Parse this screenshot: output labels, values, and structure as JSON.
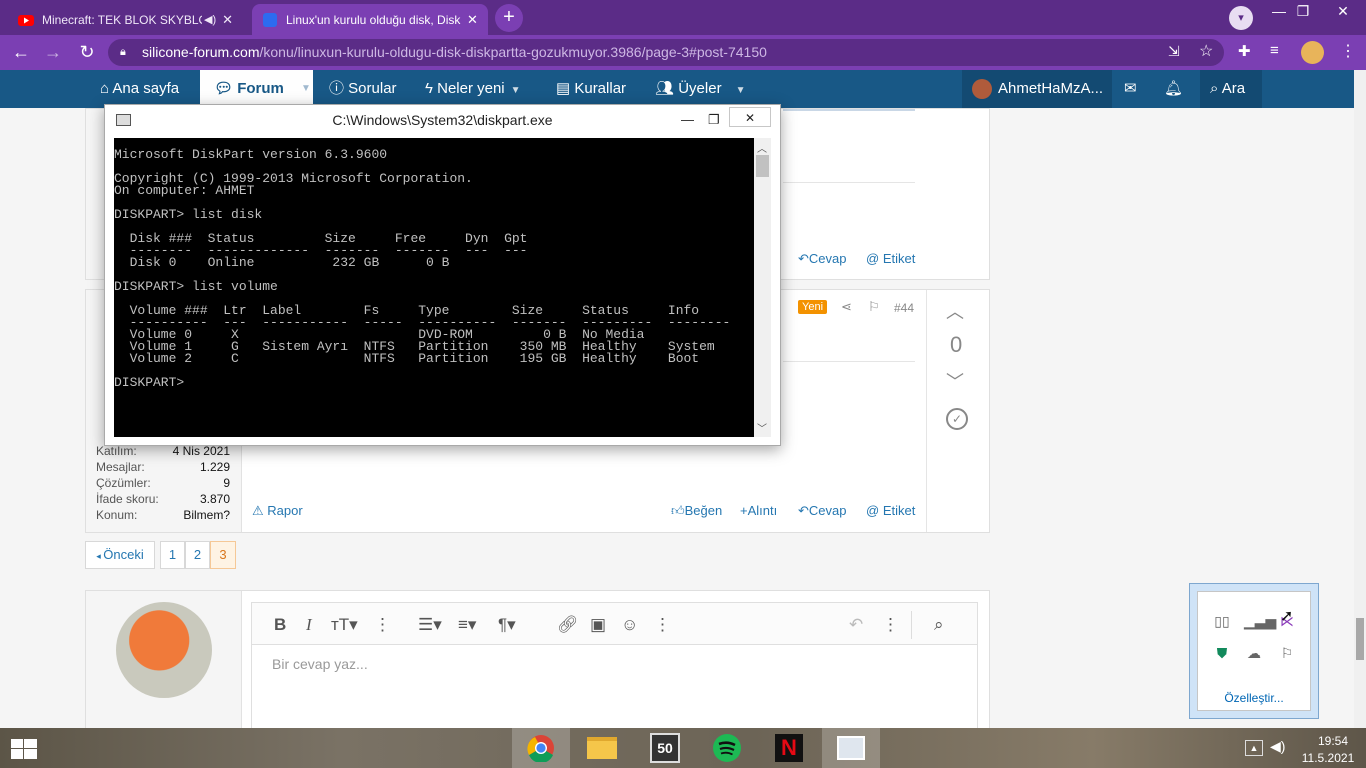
{
  "browser": {
    "tabs": [
      {
        "title": "Minecraft: TEK BLOK SKYBLOCK",
        "favicon": "youtube-icon",
        "audio": "speaker-muted-icon"
      },
      {
        "title": "Linux'un kurulu olduğu disk, Disk",
        "favicon": "silicone-forum-icon"
      }
    ],
    "url_host": "silicone-forum.com",
    "url_path": "/konu/linuxun-kurulu-oldugu-disk-diskpartta-gozukmuyor.3986/page-3#post-74150"
  },
  "forum_nav": {
    "home": "Ana sayfa",
    "forum": "Forum",
    "questions": "Sorular",
    "whats_new": "Neler yeni",
    "rules": "Kurallar",
    "members": "Üyeler",
    "username": "AhmetHaMzA...",
    "search": "Ara"
  },
  "post_top": {
    "reply": "Cevap",
    "tag": "Etiket"
  },
  "post_44": {
    "badge": "Yeni",
    "number": "#44",
    "vote_count": "0",
    "stats": [
      {
        "label": "Katılım:",
        "value": "4 Nis 2021"
      },
      {
        "label": "Mesajlar:",
        "value": "1.229"
      },
      {
        "label": "Çözümler:",
        "value": "9"
      },
      {
        "label": "İfade skoru:",
        "value": "3.870"
      },
      {
        "label": "Konum:",
        "value": "Bilmem?"
      }
    ],
    "report": "Rapor",
    "like": "Beğen",
    "quote": "Alıntı",
    "reply": "Cevap",
    "tag": "Etiket"
  },
  "pagination": {
    "prev": "Önceki",
    "pages": [
      "1",
      "2",
      "3"
    ],
    "current": "3"
  },
  "editor": {
    "placeholder": "Bir cevap yaz..."
  },
  "cmd": {
    "title": "C:\\Windows\\System32\\diskpart.exe",
    "lines": [
      "Microsoft DiskPart version 6.3.9600",
      "",
      "Copyright (C) 1999-2013 Microsoft Corporation.",
      "On computer: AHMET",
      "",
      "DISKPART> list disk",
      "",
      "  Disk ###  Status         Size     Free     Dyn  Gpt",
      "  --------  -------------  -------  -------  ---  ---",
      "  Disk 0    Online          232 GB      0 B",
      "",
      "DISKPART> list volume",
      "",
      "  Volume ###  Ltr  Label        Fs     Type        Size     Status     Info",
      "  ----------  ---  -----------  -----  ----------  -------  ---------  --------",
      "  Volume 0     X                       DVD-ROM         0 B  No Media",
      "  Volume 1     G   Sistem Ayrı  NTFS   Partition    350 MB  Healthy    System",
      "  Volume 2     C                NTFS   Partition    195 GB  Healthy    Boot",
      "",
      "DISKPART> "
    ]
  },
  "tray_popup": {
    "customize": "Özelleştir..."
  },
  "taskbar": {
    "time": "19:54",
    "date": "11.5.2021",
    "apps": [
      "chrome-icon",
      "file-explorer-icon",
      "sixty-second-icon",
      "spotify-icon",
      "netflix-icon",
      "news-window-icon"
    ]
  },
  "colors": {
    "browser_frame": "#5b2c87",
    "forum_nav": "#185886",
    "link": "#2577b1",
    "badge": "#f39200"
  }
}
